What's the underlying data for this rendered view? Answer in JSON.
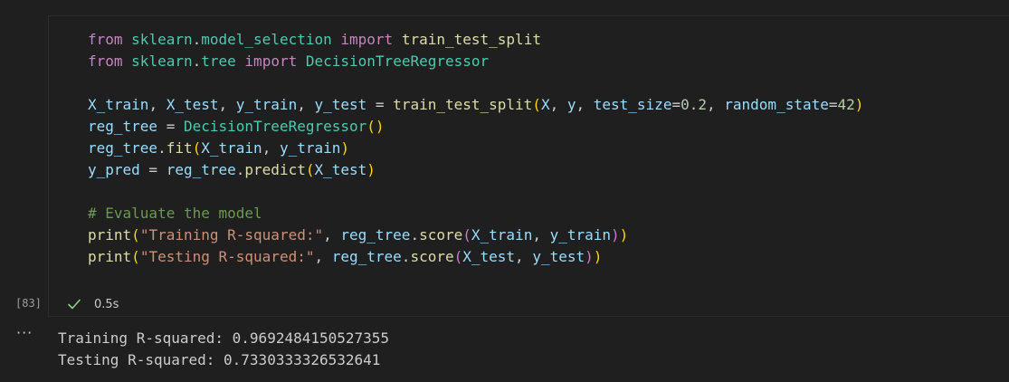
{
  "colors": {
    "background": "#1f1f1f",
    "keyword": "#c586c0",
    "module": "#4ec9b0",
    "class": "#4ec9b0",
    "function": "#dcdcaa",
    "variable": "#9cdcfe",
    "plain": "#cccccc",
    "number": "#b5cea8",
    "string": "#ce9178",
    "comment": "#6a9955",
    "bracket1": "#ffd700",
    "bracket2": "#da70d6",
    "bracket3": "#179fff",
    "success": "#89d185"
  },
  "cell": {
    "execution_count": "[83]",
    "duration": "0.5s",
    "code_lines": [
      [
        {
          "t": "from",
          "c": "keyword"
        },
        {
          "t": " ",
          "c": "plain"
        },
        {
          "t": "sklearn",
          "c": "module"
        },
        {
          "t": ".",
          "c": "plain"
        },
        {
          "t": "model_selection",
          "c": "module"
        },
        {
          "t": " ",
          "c": "plain"
        },
        {
          "t": "import",
          "c": "keyword"
        },
        {
          "t": " ",
          "c": "plain"
        },
        {
          "t": "train_test_split",
          "c": "function"
        }
      ],
      [
        {
          "t": "from",
          "c": "keyword"
        },
        {
          "t": " ",
          "c": "plain"
        },
        {
          "t": "sklearn",
          "c": "module"
        },
        {
          "t": ".",
          "c": "plain"
        },
        {
          "t": "tree",
          "c": "module"
        },
        {
          "t": " ",
          "c": "plain"
        },
        {
          "t": "import",
          "c": "keyword"
        },
        {
          "t": " ",
          "c": "plain"
        },
        {
          "t": "DecisionTreeRegressor",
          "c": "class"
        }
      ],
      [],
      [
        {
          "t": "X_train",
          "c": "variable"
        },
        {
          "t": ", ",
          "c": "plain"
        },
        {
          "t": "X_test",
          "c": "variable"
        },
        {
          "t": ", ",
          "c": "plain"
        },
        {
          "t": "y_train",
          "c": "variable"
        },
        {
          "t": ", ",
          "c": "plain"
        },
        {
          "t": "y_test",
          "c": "variable"
        },
        {
          "t": " = ",
          "c": "plain"
        },
        {
          "t": "train_test_split",
          "c": "function"
        },
        {
          "t": "(",
          "c": "bracket1"
        },
        {
          "t": "X",
          "c": "variable"
        },
        {
          "t": ", ",
          "c": "plain"
        },
        {
          "t": "y",
          "c": "variable"
        },
        {
          "t": ", ",
          "c": "plain"
        },
        {
          "t": "test_size",
          "c": "variable"
        },
        {
          "t": "=",
          "c": "plain"
        },
        {
          "t": "0.2",
          "c": "number"
        },
        {
          "t": ", ",
          "c": "plain"
        },
        {
          "t": "random_state",
          "c": "variable"
        },
        {
          "t": "=",
          "c": "plain"
        },
        {
          "t": "42",
          "c": "number"
        },
        {
          "t": ")",
          "c": "bracket1"
        }
      ],
      [
        {
          "t": "reg_tree",
          "c": "variable"
        },
        {
          "t": " = ",
          "c": "plain"
        },
        {
          "t": "DecisionTreeRegressor",
          "c": "class"
        },
        {
          "t": "()",
          "c": "bracket1"
        }
      ],
      [
        {
          "t": "reg_tree",
          "c": "variable"
        },
        {
          "t": ".",
          "c": "plain"
        },
        {
          "t": "fit",
          "c": "function"
        },
        {
          "t": "(",
          "c": "bracket1"
        },
        {
          "t": "X_train",
          "c": "variable"
        },
        {
          "t": ", ",
          "c": "plain"
        },
        {
          "t": "y_train",
          "c": "variable"
        },
        {
          "t": ")",
          "c": "bracket1"
        }
      ],
      [
        {
          "t": "y_pred",
          "c": "variable"
        },
        {
          "t": " = ",
          "c": "plain"
        },
        {
          "t": "reg_tree",
          "c": "variable"
        },
        {
          "t": ".",
          "c": "plain"
        },
        {
          "t": "predict",
          "c": "function"
        },
        {
          "t": "(",
          "c": "bracket1"
        },
        {
          "t": "X_test",
          "c": "variable"
        },
        {
          "t": ")",
          "c": "bracket1"
        }
      ],
      [],
      [
        {
          "t": "# Evaluate the model",
          "c": "comment"
        }
      ],
      [
        {
          "t": "print",
          "c": "function"
        },
        {
          "t": "(",
          "c": "bracket1"
        },
        {
          "t": "\"Training R-squared:\"",
          "c": "string"
        },
        {
          "t": ", ",
          "c": "plain"
        },
        {
          "t": "reg_tree",
          "c": "variable"
        },
        {
          "t": ".",
          "c": "plain"
        },
        {
          "t": "score",
          "c": "function"
        },
        {
          "t": "(",
          "c": "bracket2"
        },
        {
          "t": "X_train",
          "c": "variable"
        },
        {
          "t": ", ",
          "c": "plain"
        },
        {
          "t": "y_train",
          "c": "variable"
        },
        {
          "t": ")",
          "c": "bracket2"
        },
        {
          "t": ")",
          "c": "bracket1"
        }
      ],
      [
        {
          "t": "print",
          "c": "function"
        },
        {
          "t": "(",
          "c": "bracket1"
        },
        {
          "t": "\"Testing R-squared:\"",
          "c": "string"
        },
        {
          "t": ", ",
          "c": "plain"
        },
        {
          "t": "reg_tree",
          "c": "variable"
        },
        {
          "t": ".",
          "c": "plain"
        },
        {
          "t": "score",
          "c": "function"
        },
        {
          "t": "(",
          "c": "bracket2"
        },
        {
          "t": "X_test",
          "c": "variable"
        },
        {
          "t": ", ",
          "c": "plain"
        },
        {
          "t": "y_test",
          "c": "variable"
        },
        {
          "t": ")",
          "c": "bracket2"
        },
        {
          "t": ")",
          "c": "bracket1"
        }
      ]
    ]
  },
  "output": {
    "toggle_label": "···",
    "lines": [
      "Training R-squared: 0.9692484150527355",
      "Testing R-squared: 0.7330333326532641"
    ]
  }
}
